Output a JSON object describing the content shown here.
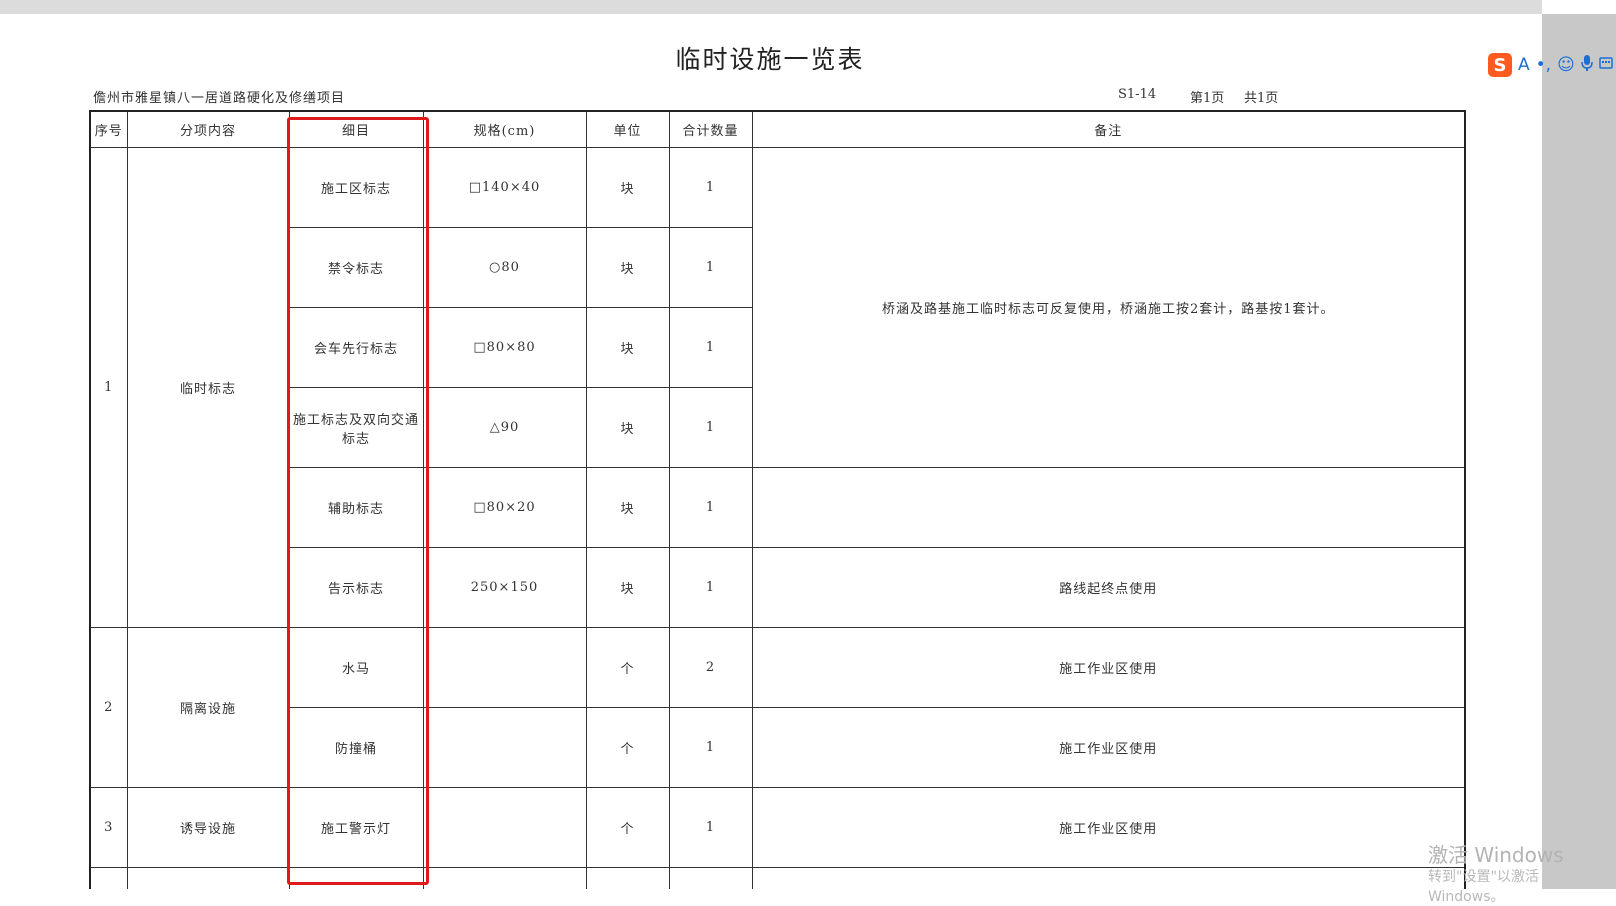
{
  "document": {
    "title": "临时设施一览表",
    "project": "儋州市雅星镇八一居道路硬化及修缮项目",
    "code": "S1-14",
    "page_no": "第1页",
    "page_total": "共1页"
  },
  "table": {
    "headers": [
      "序号",
      "分项内容",
      "细目",
      "规格(cm)",
      "单位",
      "合计数量",
      "备注"
    ],
    "groups": [
      {
        "no": "1",
        "category": "临时标志"
      },
      {
        "no": "2",
        "category": "隔离设施"
      },
      {
        "no": "3",
        "category": "诱导设施"
      }
    ],
    "rows": [
      {
        "item": "施工区标志",
        "spec": "□140×40",
        "unit": "块",
        "qty": "1"
      },
      {
        "item": "禁令标志",
        "spec": "○80",
        "unit": "块",
        "qty": "1"
      },
      {
        "item": "会车先行标志",
        "spec": "□80×80",
        "unit": "块",
        "qty": "1"
      },
      {
        "item": "施工标志及双向交通标志",
        "spec": "△90",
        "unit": "块",
        "qty": "1"
      },
      {
        "item": "辅助标志",
        "spec": "□80×20",
        "unit": "块",
        "qty": "1"
      },
      {
        "item": "告示标志",
        "spec": "250×150",
        "unit": "块",
        "qty": "1",
        "remark": "路线起终点使用"
      },
      {
        "item": "水马",
        "spec": "",
        "unit": "个",
        "qty": "2",
        "remark": "施工作业区使用"
      },
      {
        "item": "防撞桶",
        "spec": "",
        "unit": "个",
        "qty": "1",
        "remark": "施工作业区使用"
      },
      {
        "item": "施工警示灯",
        "spec": "",
        "unit": "个",
        "qty": "1",
        "remark": "施工作业区使用"
      }
    ],
    "merged_remark": "桥涵及路基施工临时标志可反复使用，桥涵施工按2套计，路基按1套计。"
  },
  "overlay": {
    "highlight_color": "#e0191b",
    "ime_icons": [
      "sogou-logo-icon",
      "font-a-icon",
      "punctuation-icon",
      "emoji-icon",
      "microphone-icon",
      "keyboard-icon"
    ],
    "ime_logo_text": "S",
    "ime_a_text": "A",
    "watermark_title": "激活 Windows",
    "watermark_sub": "转到\"设置\"以激活 Windows。"
  }
}
